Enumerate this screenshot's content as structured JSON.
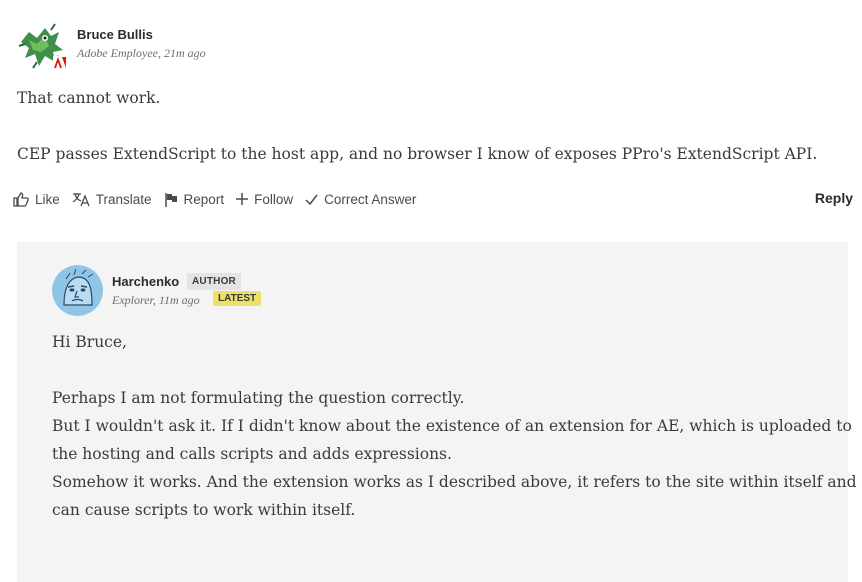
{
  "post1": {
    "author": "Bruce Bullis",
    "meta": "Adobe Employee, 21m ago",
    "paragraphs": [
      "That cannot work.",
      "CEP passes ExtendScript to the host app, and no browser I know of exposes PPro's ExtendScript API."
    ],
    "actions": {
      "like": "Like",
      "translate": "Translate",
      "report": "Report",
      "follow": "Follow",
      "correct_answer": "Correct Answer",
      "reply": "Reply"
    }
  },
  "reply": {
    "author": "Harchenko",
    "author_badge": "AUTHOR",
    "meta": "Explorer, 11m ago",
    "latest_badge": "LATEST",
    "greeting": "Hi Bruce,",
    "lines": [
      "Perhaps I am not formulating the question correctly.",
      "But I wouldn't ask it. If I didn't know about the existence of an extension for AE, which is uploaded to",
      "the hosting and calls scripts and adds expressions.",
      "Somehow it works. And the extension works as I described above, it refers to the site within itself and",
      "can cause scripts to work within itself."
    ]
  },
  "colors": {
    "reply_background": "#f4f4f4",
    "latest_badge": "#ece06a",
    "author_badge": "#e3e3e3",
    "adobe_red": "#eb1000"
  },
  "icons": [
    "avatar-bruce",
    "adobe-logo-icon",
    "thumbs-up-icon",
    "translate-icon",
    "flag-icon",
    "plus-icon",
    "checkmark-icon",
    "avatar-harchenko"
  ]
}
